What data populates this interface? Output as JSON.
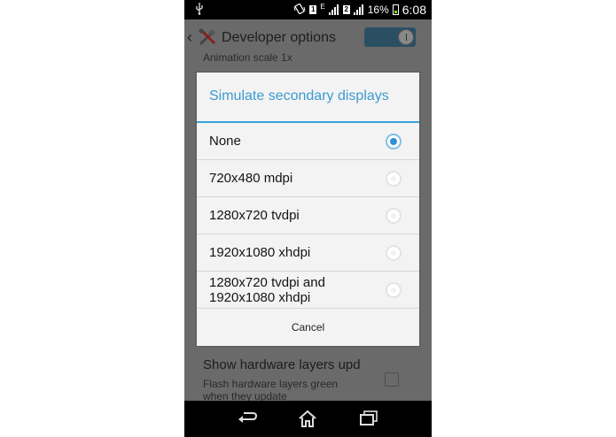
{
  "status_bar": {
    "battery_percent": "16%",
    "time": "6:08",
    "network_type": "E",
    "sim1": "1",
    "sim2": "2"
  },
  "action_bar": {
    "title": "Developer options",
    "toggle_label": "I"
  },
  "background": {
    "top_partial_text": "Animation scale 1x",
    "item_title": "Show hardware layers upd",
    "item_subtitle": "Flash hardware layers green when they update"
  },
  "dialog": {
    "title": "Simulate secondary displays",
    "options": [
      {
        "label": "None",
        "selected": true
      },
      {
        "label": "720x480 mdpi",
        "selected": false
      },
      {
        "label": "1280x720 tvdpi",
        "selected": false
      },
      {
        "label": "1920x1080 xhdpi",
        "selected": false
      },
      {
        "label_line1": "1280x720 tvdpi and",
        "label_line2": "1920x1080 xhdpi",
        "selected": false
      }
    ],
    "cancel_label": "Cancel"
  },
  "colors": {
    "accent": "#3b9ad1",
    "radio_selected": "#2f8fd3",
    "toggle_on": "#2a4f63"
  },
  "icons": {
    "status": [
      "usb-icon",
      "vibrate-icon",
      "signal-icon",
      "battery-icon"
    ],
    "nav": [
      "back-icon",
      "home-icon",
      "recents-icon"
    ]
  }
}
